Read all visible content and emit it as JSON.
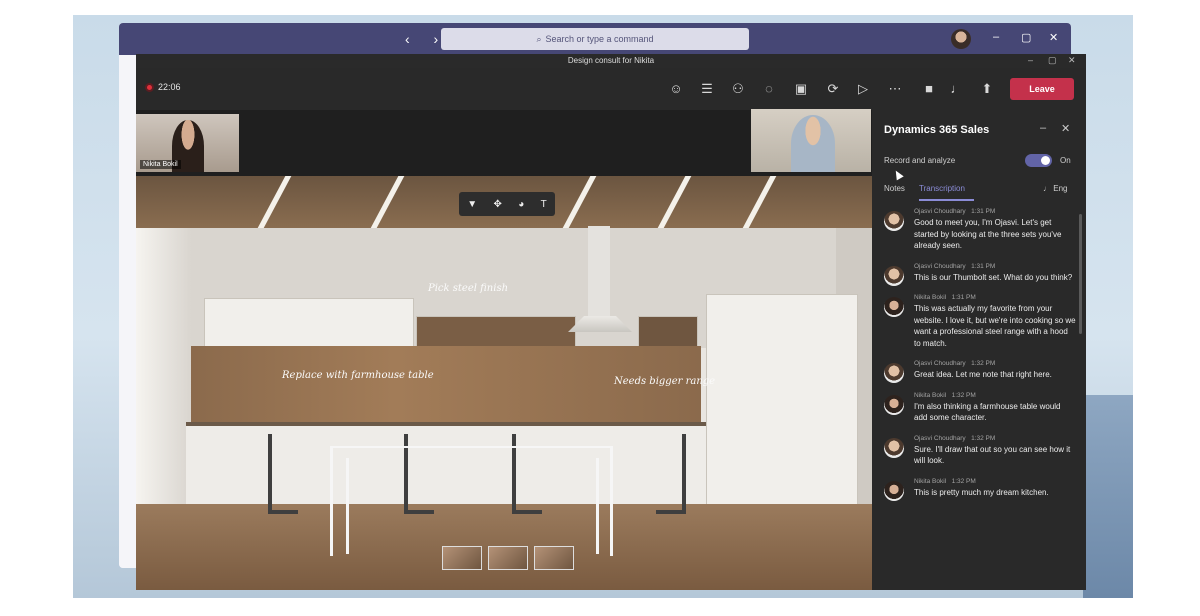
{
  "topbar": {
    "nav_arrows": "‹ ›",
    "search_placeholder": "Search or type a command",
    "window_controls": [
      "–",
      "▢",
      "✕"
    ]
  },
  "meeting": {
    "title": "Design consult for Nikita",
    "timer": "22:06",
    "leave_label": "Leave",
    "toolbar_icons": [
      "reactions-icon",
      "chat-list-icon",
      "people-icon",
      "chat-icon",
      "whiteboard-icon",
      "apps-icon",
      "share-tray-icon",
      "more-icon",
      "camera-icon",
      "mic-icon",
      "share-screen-icon"
    ]
  },
  "participants": {
    "thumb_left_name": "Nikita Bokil"
  },
  "canvas": {
    "annotations": {
      "backsplash": "Pick steel finish",
      "table": "Replace with farmhouse table",
      "range": "Needs bigger range"
    },
    "ink_tools": [
      "▼",
      "✥",
      "◕",
      "T"
    ]
  },
  "panel": {
    "title": "Dynamics 365 Sales",
    "record_label": "Record and analyze",
    "toggle_state": "On",
    "tabs": [
      "Notes",
      "Transcription"
    ],
    "language": "Eng",
    "transcript": [
      {
        "speaker": "Ojasvi Choudhary",
        "time": "1:31 PM",
        "avatar": "ojasvi",
        "text": "Good to meet you, I'm Ojasvi. Let's get started by looking at the three sets you've already seen."
      },
      {
        "speaker": "Ojasvi Choudhary",
        "time": "1:31 PM",
        "avatar": "ojasvi",
        "text": "This is our Thumbolt set. What do you think?"
      },
      {
        "speaker": "Nikita Bokil",
        "time": "1:31 PM",
        "avatar": "nikita",
        "text": "This was actually my favorite from your website. I love it, but we're into cooking so we want a professional steel range with a hood to match."
      },
      {
        "speaker": "Ojasvi Choudhary",
        "time": "1:32 PM",
        "avatar": "ojasvi",
        "text": "Great idea. Let me note that right here."
      },
      {
        "speaker": "Nikita Bokil",
        "time": "1:32 PM",
        "avatar": "nikita",
        "text": "I'm also thinking a farmhouse table would add some character."
      },
      {
        "speaker": "Ojasvi Choudhary",
        "time": "1:32 PM",
        "avatar": "ojasvi",
        "text": "Sure. I'll draw that out so you can see how it will look."
      },
      {
        "speaker": "Nikita Bokil",
        "time": "1:32 PM",
        "avatar": "nikita",
        "text": "This is pretty much my dream kitchen."
      }
    ]
  },
  "colors": {
    "teams_purple": "#464775",
    "leave_red": "#c4314b",
    "accent": "#8b8cd6",
    "panel_bg": "#292929"
  }
}
